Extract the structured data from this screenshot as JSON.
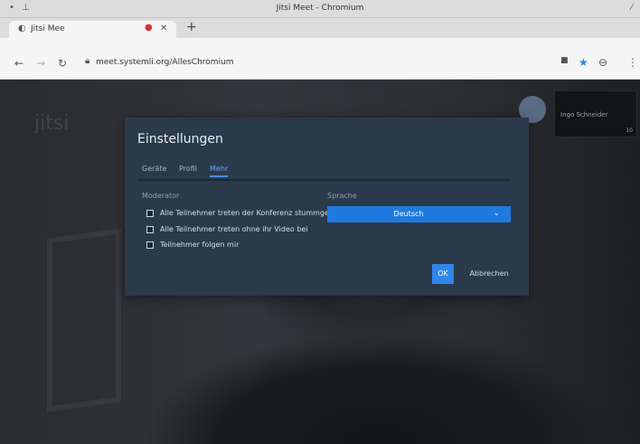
{
  "window": {
    "title": "Jitsi Meet - Chromium"
  },
  "browser": {
    "tab_label": "Jitsi Mee",
    "url": "meet.systemli.org/AllesChromium"
  },
  "page": {
    "watermark": "jitsi",
    "thumbnail_name": "Ingo Schneider",
    "thumbnail_count": "10"
  },
  "dialog": {
    "title": "Einstellungen",
    "tabs": [
      {
        "label": "Geräte"
      },
      {
        "label": "Profil"
      },
      {
        "label": "Mehr"
      }
    ],
    "active_tab": "Mehr",
    "moderator": {
      "label": "Moderator",
      "options": [
        {
          "label": "Alle Teilnehmer treten der Konferenz stummgeschaltet bei",
          "checked": false
        },
        {
          "label": "Alle Teilnehmer treten ohne ihr Video bei",
          "checked": false
        },
        {
          "label": "Teilnehmer folgen mir",
          "checked": false
        }
      ]
    },
    "language": {
      "label": "Sprache",
      "selected": "Deutsch"
    },
    "ok_label": "OK",
    "cancel_label": "Abbrechen"
  },
  "colors": {
    "accent": "#1f7ae0",
    "dialog_bg": "#2b3a4a"
  }
}
